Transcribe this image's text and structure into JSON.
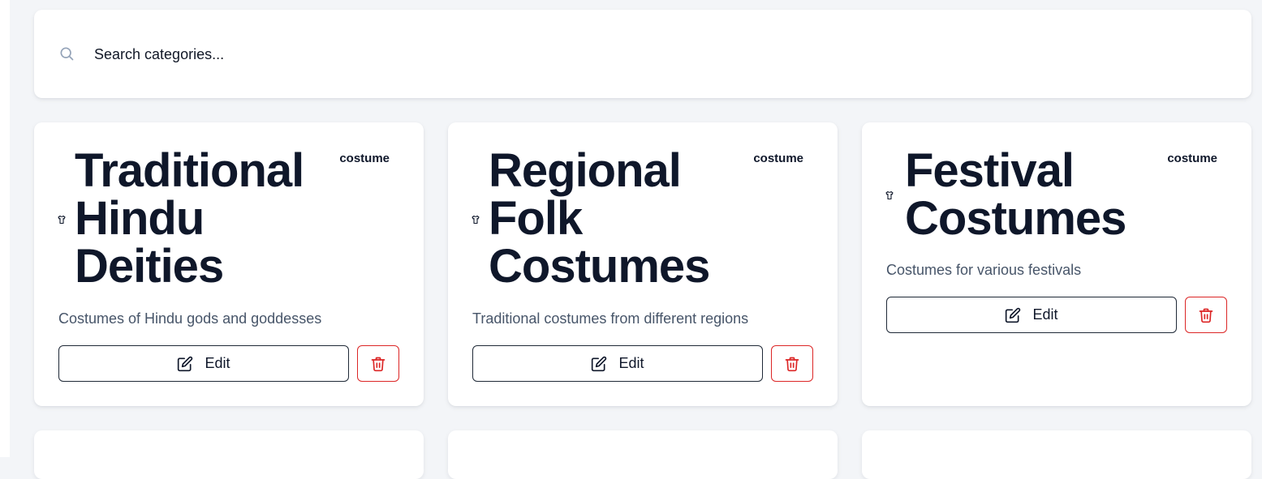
{
  "search": {
    "placeholder": "Search categories...",
    "icon": "search-icon"
  },
  "colors": {
    "background": "#f3f5f8",
    "card": "#ffffff",
    "title": "#0f172a",
    "description": "#475569",
    "danger": "#dc2626"
  },
  "categories": [
    {
      "title": "Traditional Hindu Deities",
      "badge": "costume",
      "description": "Costumes of Hindu gods and goddesses",
      "icon": "shirt-icon",
      "edit_label": "Edit"
    },
    {
      "title": "Regional Folk Costumes",
      "badge": "costume",
      "description": "Traditional costumes from different regions",
      "icon": "shirt-icon",
      "edit_label": "Edit"
    },
    {
      "title": "Festival Costumes",
      "badge": "costume",
      "description": "Costumes for various festivals",
      "icon": "shirt-icon",
      "edit_label": "Edit"
    }
  ]
}
